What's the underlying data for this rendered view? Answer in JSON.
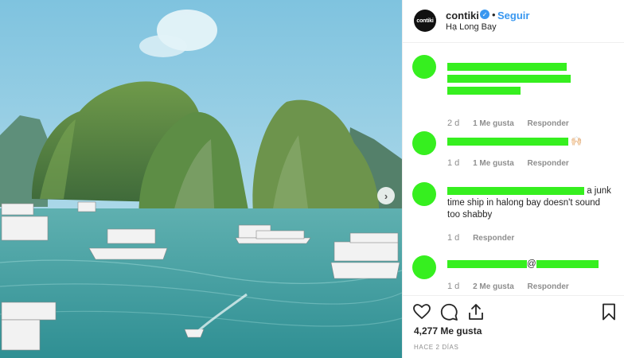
{
  "post": {
    "username": "contiki",
    "avatar_text": "contiki",
    "follow_label": "Seguir",
    "separator": "•",
    "location": "Hạ Long Bay"
  },
  "comments": [
    {
      "text_segments": [
        "",
        ""
      ],
      "ago": "2 d",
      "likes": "1 Me gusta",
      "reply": "Responder"
    },
    {
      "text_segments": [
        "🙌🏻"
      ],
      "ago": "1 d",
      "likes": "1 Me gusta",
      "reply": "Responder"
    },
    {
      "text_segments": [
        "a junk",
        "time ship in halong bay doesn't sound",
        "too shabby"
      ],
      "ago": "1 d",
      "reply": "Responder"
    },
    {
      "text_segments": [
        "@"
      ],
      "ago": "1 d",
      "likes": "2 Me gusta",
      "reply": "Responder"
    }
  ],
  "actions": {
    "likes_count": "4,277 Me gusta",
    "time_ago": "HACE 2 DÍAS"
  },
  "icons": {
    "verified": "verified-badge-icon",
    "next": "chevron-right-icon",
    "like": "heart-icon",
    "comment": "comment-bubble-icon",
    "share": "share-icon",
    "save": "bookmark-icon"
  },
  "colors": {
    "accent": "#3897f0",
    "redaction": "#36ef1f",
    "muted": "#8e8e8e"
  }
}
